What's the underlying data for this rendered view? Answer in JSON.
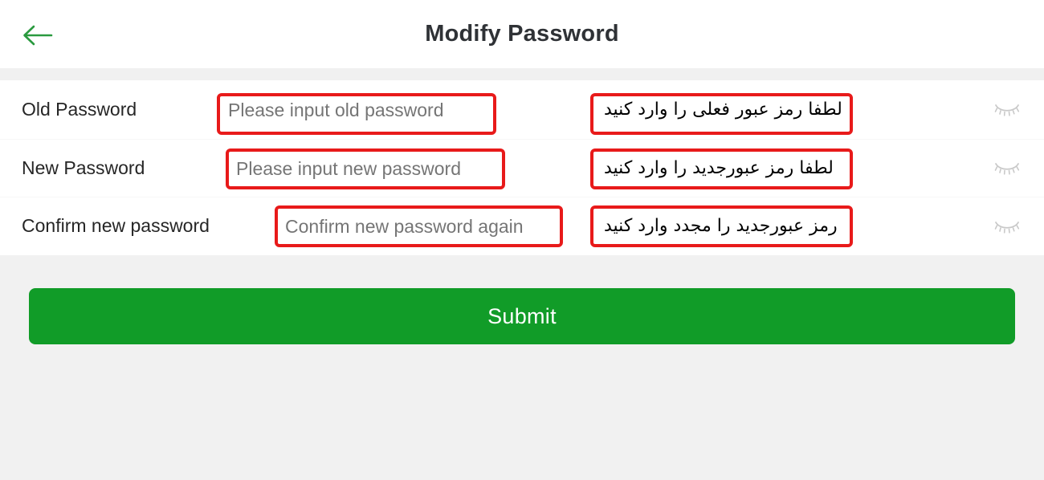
{
  "header": {
    "title": "Modify Password",
    "back_icon": "arrow-left-icon",
    "accent_color": "#2a9a3f"
  },
  "colors": {
    "annotation_red": "#e81a1a",
    "submit_green": "#119c28",
    "page_background": "#f1f1f1",
    "label_text": "#262626",
    "placeholder_text": "#b3b3b3"
  },
  "form": {
    "rows": [
      {
        "label": "Old Password",
        "placeholder": "Please input old password",
        "value": "",
        "translation_fa": "لطفا رمز عبور فعلی را وارد کنید",
        "toggle_icon": "eye-closed-icon"
      },
      {
        "label": "New Password",
        "placeholder": "Please input new password",
        "value": "",
        "translation_fa": "لطفا رمز عبورجدید را وارد کنید",
        "toggle_icon": "eye-closed-icon"
      },
      {
        "label": "Confirm new password",
        "placeholder": "Confirm new password again",
        "value": "",
        "translation_fa": "رمز عبورجدید را مجدد وارد کنید",
        "toggle_icon": "eye-closed-icon"
      }
    ]
  },
  "submit": {
    "label": "Submit"
  }
}
